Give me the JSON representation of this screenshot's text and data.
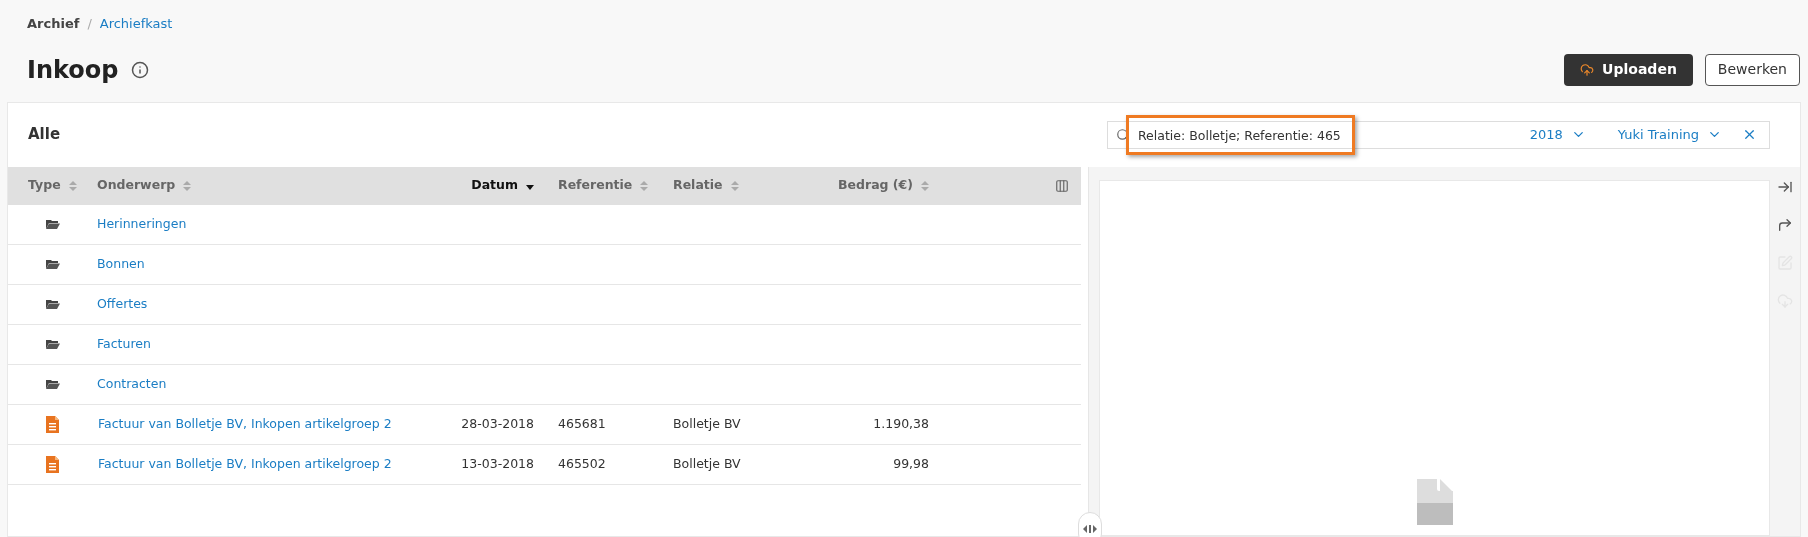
{
  "breadcrumb": {
    "separator": "/",
    "items": [
      {
        "label": "Archief",
        "link": false
      },
      {
        "label": "Archiefkast",
        "link": true
      }
    ]
  },
  "page_title": "Inkoop",
  "header_buttons": [
    {
      "label": "Uploaden",
      "kind": "primary"
    },
    {
      "label": "Bewerken",
      "kind": "secondary"
    }
  ],
  "panel_title": "Alle",
  "search": {
    "value": "Relatie: Bolletje; Referentie: 465",
    "highlighted": true,
    "year": "2018",
    "administration": "Yuki Training"
  },
  "table": {
    "columns": [
      {
        "label": "Type",
        "sorted": false
      },
      {
        "label": "Onderwerp",
        "sorted": false
      },
      {
        "label": "Datum",
        "sorted": true
      },
      {
        "label": "Referentie",
        "sorted": false
      },
      {
        "label": "Relatie",
        "sorted": false
      },
      {
        "label": "Bedrag (€)",
        "sorted": false
      }
    ],
    "rows": [
      {
        "kind": "folder",
        "subject": "Herinneringen"
      },
      {
        "kind": "folder",
        "subject": "Bonnen"
      },
      {
        "kind": "folder",
        "subject": "Offertes"
      },
      {
        "kind": "folder",
        "subject": "Facturen"
      },
      {
        "kind": "folder",
        "subject": "Contracten"
      },
      {
        "kind": "document",
        "subject": "Factuur van Bolletje BV, Inkopen artikelgroep 2",
        "date": "28-03-2018",
        "reference": "465681",
        "relation": "Bolletje BV",
        "amount": "1.190,38"
      },
      {
        "kind": "document",
        "subject": "Factuur van Bolletje BV, Inkopen artikelgroep 2",
        "date": "13-03-2018",
        "reference": "465502",
        "relation": "Bolletje BV",
        "amount": "99,98"
      }
    ]
  },
  "preview_tools": [
    {
      "kind": "collapse",
      "disabled": false
    },
    {
      "kind": "forward",
      "disabled": false
    },
    {
      "kind": "edit",
      "disabled": true
    },
    {
      "kind": "download",
      "disabled": true
    }
  ]
}
